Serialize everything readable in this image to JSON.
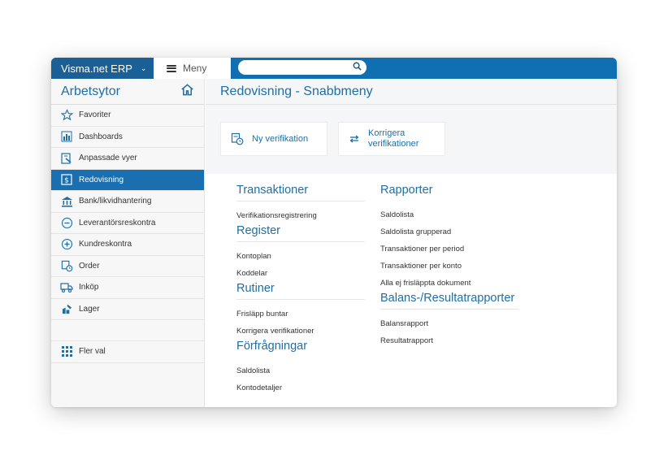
{
  "topbar": {
    "brand": "Visma.net ERP",
    "brand_chevron": "⌄",
    "menu_label": "Meny",
    "search_placeholder": ""
  },
  "sidebar": {
    "title": "Arbetsytor",
    "items": [
      {
        "label": "Favoriter",
        "icon": "star-icon"
      },
      {
        "label": "Dashboards",
        "icon": "bar-chart-icon"
      },
      {
        "label": "Anpassade vyer",
        "icon": "custom-view-icon"
      },
      {
        "label": "Redovisning",
        "icon": "dollar-doc-icon",
        "active": true
      },
      {
        "label": "Bank/likvidhantering",
        "icon": "bank-icon"
      },
      {
        "label": "Leverantörsreskontra",
        "icon": "minus-circle-icon"
      },
      {
        "label": "Kundreskontra",
        "icon": "plus-circle-icon"
      },
      {
        "label": "Order",
        "icon": "order-icon"
      },
      {
        "label": "Inköp",
        "icon": "truck-icon"
      },
      {
        "label": "Lager",
        "icon": "warehouse-icon"
      }
    ],
    "more": "Fler val"
  },
  "main": {
    "title": "Redovisning - Snabbmeny",
    "quick": [
      {
        "label": "Ny verifikation",
        "icon": "new-voucher-icon"
      },
      {
        "label_line1": "Korrigera",
        "label_line2": "verifikationer",
        "icon": "swap-arrows-icon"
      }
    ],
    "col1": {
      "transaktioner": {
        "title": "Transaktioner",
        "links": [
          "Verifikationsregistrering"
        ]
      },
      "register": {
        "title": "Register",
        "links": [
          "Kontoplan",
          "Koddelar"
        ]
      },
      "rutiner": {
        "title": "Rutiner",
        "links": [
          "Frisläpp buntar",
          "Korrigera verifikationer"
        ]
      },
      "forfragningar": {
        "title": "Förfrågningar",
        "links": [
          "Saldolista",
          "Kontodetaljer"
        ]
      }
    },
    "col2": {
      "rapporter": {
        "title": "Rapporter",
        "links": [
          "Saldolista",
          "Saldolista grupperad",
          "Transaktioner per period",
          "Transaktioner per konto",
          "Alla ej frisläppta dokument"
        ]
      },
      "balans": {
        "title": "Balans-/Resultatrapporter",
        "links": [
          "Balansrapport",
          "Resultatrapport"
        ]
      }
    }
  },
  "colors": {
    "brand": "#0f6fb0",
    "brand_dark": "#1a5f96",
    "accent_text": "#1d6fa7"
  }
}
